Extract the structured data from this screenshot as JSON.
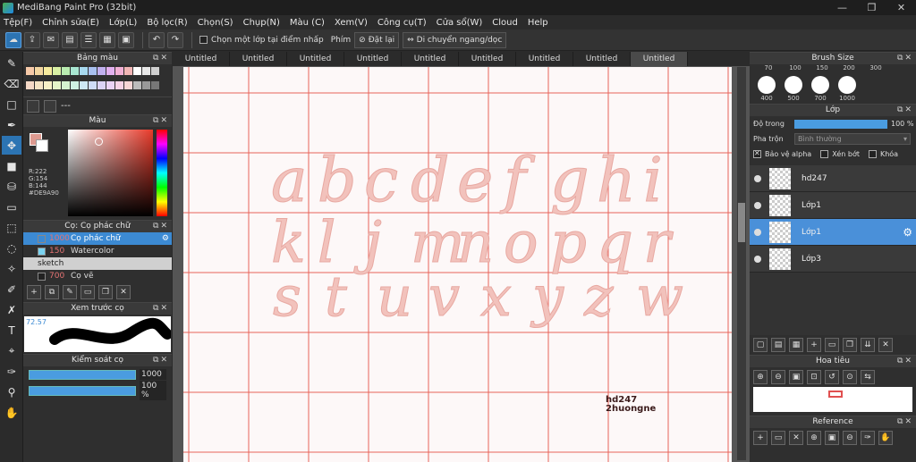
{
  "window": {
    "title": "MediBang Paint Pro (32bit)",
    "controls": [
      "—",
      "❐",
      "✕"
    ]
  },
  "menu": [
    "Tệp(F)",
    "Chỉnh sửa(E)",
    "Lớp(L)",
    "Bộ lọc(R)",
    "Chọn(S)",
    "Chụp(N)",
    "Màu (C)",
    "Xem(V)",
    "Công cụ(T)",
    "Cửa sổ(W)",
    "Cloud",
    "Help"
  ],
  "toolbar": {
    "pick_layer_label": "Chọn một lớp tại điểm nhấp",
    "key_label": "Phím",
    "reset_label": "Đặt lại",
    "move_label": "Di chuyển ngang/dọc"
  },
  "left": {
    "palette_title": "Bảng màu",
    "palette_name": "---",
    "palette": [
      "#f6c9a8",
      "#f3d6a0",
      "#f7eb9e",
      "#d9f0a4",
      "#b9ecb0",
      "#a9e7d2",
      "#a7d9ef",
      "#a9c1f0",
      "#c1b0ef",
      "#e2b0ef",
      "#f2b0d5",
      "#f2b6b6",
      "#ffffff",
      "#e8e8e8",
      "#d0d0d0",
      "#f5d9c7",
      "#f5e4c5",
      "#f7f0c7",
      "#e5f4c9",
      "#d5f2d0",
      "#cff0e3",
      "#cde8f5",
      "#cfdcf6",
      "#dcd3f5",
      "#ebd3f5",
      "#f6d3e6",
      "#f6d6d6",
      "#bbbbbb",
      "#999999",
      "#777777"
    ],
    "color_title": "Màu",
    "rgb": [
      "R:222",
      "G:154",
      "B:144",
      "#DE9A90"
    ],
    "brush_title": "Cọ: Cọ phác chữ",
    "brushes": [
      {
        "size": "1000",
        "name": "Cọ phác chữ",
        "swatch": "#3c8ad3",
        "selected": true
      },
      {
        "size": "150",
        "name": "Watercolor",
        "swatch": "#7ad3f0",
        "selected": false
      }
    ],
    "brush_group": "sketch",
    "brush_extra": {
      "size": "700",
      "name": "Cọ vẽ"
    },
    "preview_title": "Xem trước cọ",
    "preview_value": "72.57",
    "control_title": "Kiểm soát cọ",
    "control_size": "1000",
    "control_opacity": "100 %"
  },
  "tabs": [
    "Untitled",
    "Untitled",
    "Untitled",
    "Untitled",
    "Untitled",
    "Untitled",
    "Untitled",
    "Untitled",
    "Untitled"
  ],
  "canvas": {
    "rows": [
      [
        "a",
        "b",
        "c",
        "d",
        "e",
        "f",
        "g",
        "h",
        "i"
      ],
      [
        "k",
        "l",
        "j",
        "m",
        "n",
        "o",
        "p",
        "q",
        "r"
      ],
      [
        "s",
        "t",
        "u",
        "v",
        "x",
        "y",
        "z",
        "w"
      ]
    ],
    "watermark": [
      "hd247",
      "2huongne"
    ],
    "grid_color": "#e8645a",
    "letter_color": "#f2c2bc"
  },
  "right": {
    "brushsize_title": "Brush Size",
    "sizes_top": [
      "70",
      "100",
      "150",
      "200",
      "300"
    ],
    "sizes": [
      "400",
      "500",
      "700",
      "1000"
    ],
    "layer_title": "Lớp",
    "opacity_label": "Độ trong",
    "opacity_value": "100 %",
    "blend_label": "Pha trộn",
    "blend_value": "Bình thường",
    "protect_alpha": "Bảo vệ alpha",
    "clip": "Xén bớt",
    "lock": "Khóa",
    "layers": [
      {
        "name": "hd247",
        "selected": false
      },
      {
        "name": "Lớp1",
        "selected": false
      },
      {
        "name": "Lớp1",
        "selected": true
      },
      {
        "name": "Lớp3",
        "selected": false
      }
    ],
    "nav_title": "Hoa tiêu",
    "ref_title": "Reference"
  }
}
